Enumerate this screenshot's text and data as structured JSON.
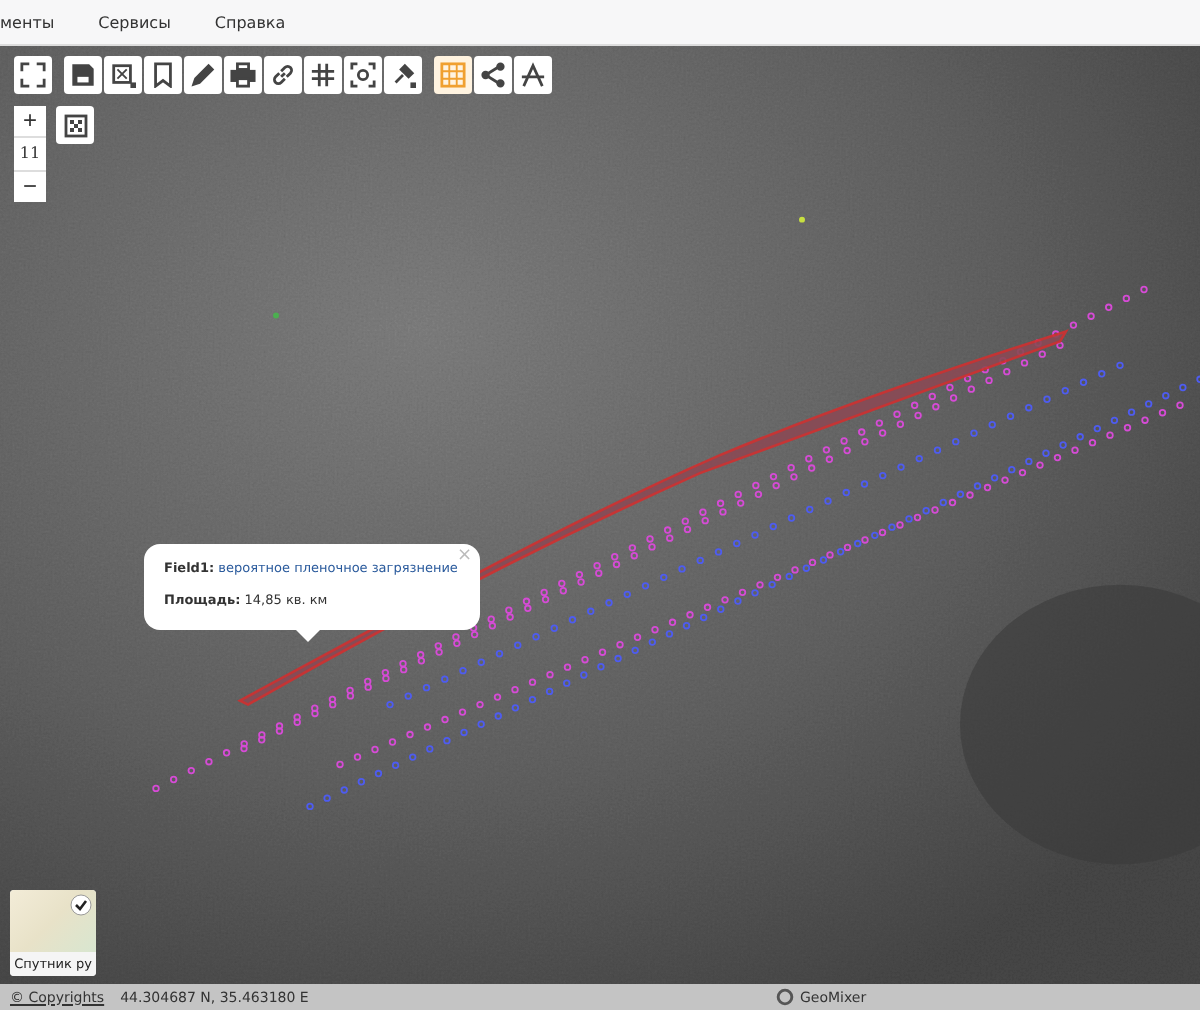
{
  "menu": {
    "items": [
      {
        "label": "менты"
      },
      {
        "label": "Сервисы"
      },
      {
        "label": "Справка"
      }
    ]
  },
  "toolbar": {
    "groups": [
      {
        "buttons": [
          {
            "kind": "fullscreen",
            "selected": false
          }
        ]
      },
      {
        "buttons": [
          {
            "kind": "save",
            "selected": false
          },
          {
            "kind": "select",
            "selected": false
          },
          {
            "kind": "bookmark",
            "selected": false
          },
          {
            "kind": "pencil",
            "selected": false
          },
          {
            "kind": "print",
            "selected": false
          },
          {
            "kind": "link",
            "selected": false
          },
          {
            "kind": "grid",
            "selected": false
          },
          {
            "kind": "zoombox",
            "selected": false
          },
          {
            "kind": "pin",
            "selected": false
          }
        ]
      },
      {
        "buttons": [
          {
            "kind": "table",
            "selected": true
          },
          {
            "kind": "share",
            "selected": false
          },
          {
            "kind": "compass",
            "selected": false
          }
        ]
      }
    ]
  },
  "zoom": {
    "plus": "+",
    "level": "11",
    "minus": "−"
  },
  "layers_button": {
    "kind": "checker"
  },
  "popup": {
    "close": "×",
    "field_label": "Field1:",
    "field_value": "вероятное пленочное  загрязнение",
    "area_label": "Площадь:",
    "area_value": "14,85 кв. км"
  },
  "basemap": {
    "caption": "Спутник ру",
    "checked": true
  },
  "status_bar": {
    "copyright": "© Copyrights",
    "coordinates": "44.304687 N, 35.463180 E",
    "brand": "GeoMixer"
  }
}
